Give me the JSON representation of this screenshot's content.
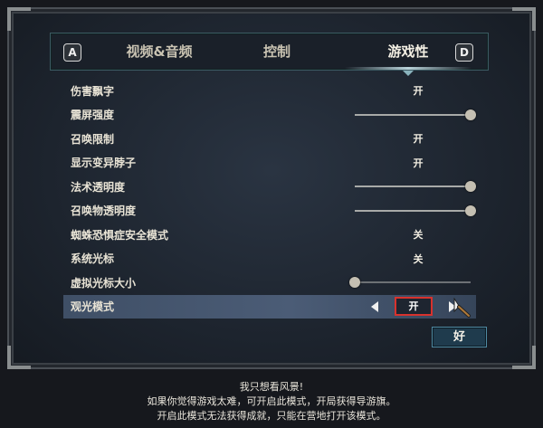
{
  "tabbar": {
    "left_key": "A",
    "right_key": "D",
    "tabs": [
      {
        "label": "视频&音频",
        "active": false
      },
      {
        "label": "控制",
        "active": false
      },
      {
        "label": "游戏性",
        "active": true
      }
    ]
  },
  "settings": [
    {
      "label": "伤害飘字",
      "type": "toggle",
      "value": "开"
    },
    {
      "label": "震屏强度",
      "type": "slider",
      "level": 1.0
    },
    {
      "label": "召唤限制",
      "type": "toggle",
      "value": "开"
    },
    {
      "label": "显示变异脖子",
      "type": "toggle",
      "value": "开"
    },
    {
      "label": "法术透明度",
      "type": "slider",
      "level": 1.0
    },
    {
      "label": "召唤物透明度",
      "type": "slider",
      "level": 1.0
    },
    {
      "label": "蜘蛛恐惧症安全模式",
      "type": "toggle",
      "value": "关"
    },
    {
      "label": "系统光标",
      "type": "toggle",
      "value": "关"
    },
    {
      "label": "虚拟光标大小",
      "type": "slider",
      "level": 0.0
    },
    {
      "label": "观光模式",
      "type": "selector",
      "value": "开",
      "selected": true
    }
  ],
  "ok_button": {
    "label": "好"
  },
  "description": [
    "我只想看风景!",
    "如果你觉得游戏太难，可开启此模式，开局获得导游旗。",
    "开启此模式无法获得成就，只能在营地打开该模式。"
  ],
  "colors": {
    "highlight_border": "#d8322d",
    "accent": "#4f8aa3"
  }
}
